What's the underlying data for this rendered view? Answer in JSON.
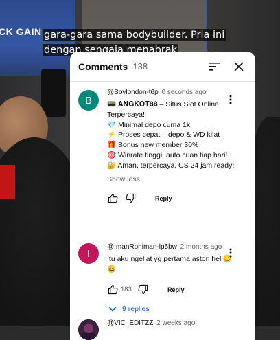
{
  "video": {
    "logo_text": "CK GAIN",
    "caption_lines": [
      "gara-gara sama bodybuilder. Pria ini",
      "dengan sengaja menabrak"
    ]
  },
  "comments_panel": {
    "title": "Comments",
    "count": "138",
    "sort_icon": "sort-icon",
    "close_icon": "close-icon",
    "comments": [
      {
        "author": "@Boylondon-t6p",
        "time": "0 seconds ago",
        "avatar_letter": "B",
        "avatar_color": "#00897b",
        "lines": [
          "📟 𝐀𝐍𝐆𝐊𝐎𝐓𝟖𝟖 – Situs Slot Online Terpercaya!",
          "💎 Minimal depo cuma 1k",
          "⚡ Proses cepat – depo & WD kilat",
          "🎁 Bonus new member 30%",
          "🎯 Winrate tinggi, auto cuan tiap hari!",
          "🔐 Aman, terpercaya, CS 24 jam ready!"
        ],
        "show_less": "Show less",
        "reply_label": "Reply"
      },
      {
        "author": "@ImanRohiman-lp5bw",
        "time": "2 months ago",
        "avatar_letter": "I",
        "avatar_color": "#c2185b",
        "text": "Itu aku ngeliat yg pertama aston hell😄 😄",
        "likes": "183",
        "reply_label": "Reply",
        "replies_label": "9 replies"
      },
      {
        "author": "@VIC_EDITZZ",
        "time": "2 weeks ago"
      }
    ]
  },
  "colors": {
    "link_blue": "#065fd4",
    "panel_bg": "#ffffff"
  }
}
